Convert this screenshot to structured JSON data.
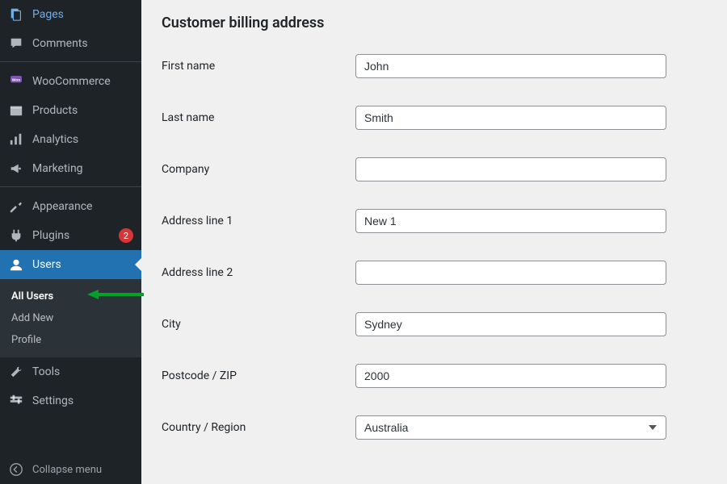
{
  "sidebar": {
    "items": [
      {
        "label": "Pages",
        "icon": "pages"
      },
      {
        "label": "Comments",
        "icon": "comment"
      },
      {
        "label": "WooCommerce",
        "icon": "woo"
      },
      {
        "label": "Products",
        "icon": "products"
      },
      {
        "label": "Analytics",
        "icon": "analytics"
      },
      {
        "label": "Marketing",
        "icon": "marketing"
      },
      {
        "label": "Appearance",
        "icon": "appearance"
      },
      {
        "label": "Plugins",
        "icon": "plugins",
        "badge": "2"
      },
      {
        "label": "Users",
        "icon": "users",
        "active": true
      },
      {
        "label": "Tools",
        "icon": "tools"
      },
      {
        "label": "Settings",
        "icon": "settings"
      }
    ],
    "submenu": [
      {
        "label": "All Users",
        "current": true
      },
      {
        "label": "Add New"
      },
      {
        "label": "Profile"
      }
    ],
    "collapse_label": "Collapse menu"
  },
  "main": {
    "section_title": "Customer billing address",
    "fields": {
      "first_name": {
        "label": "First name",
        "value": "John"
      },
      "last_name": {
        "label": "Last name",
        "value": "Smith"
      },
      "company": {
        "label": "Company",
        "value": ""
      },
      "address1": {
        "label": "Address line 1",
        "value": "New 1"
      },
      "address2": {
        "label": "Address line 2",
        "value": ""
      },
      "city": {
        "label": "City",
        "value": "Sydney"
      },
      "postcode": {
        "label": "Postcode / ZIP",
        "value": "2000"
      },
      "country": {
        "label": "Country / Region",
        "value": "Australia"
      }
    }
  }
}
